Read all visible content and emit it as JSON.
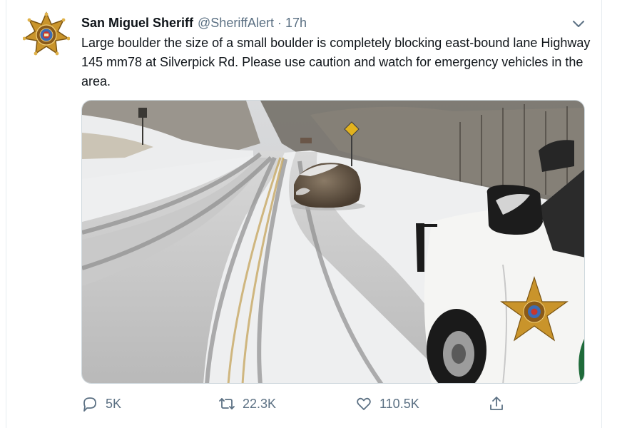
{
  "tweet": {
    "display_name": "San Miguel Sheriff",
    "handle": "@SheriffAlert",
    "separator": "·",
    "time": "17h",
    "text": "Large boulder the size of a small boulder is completely blocking east-bound lane Highway 145 mm78 at Silverpick Rd. Please use caution and watch for emergency vehicles in the area.",
    "avatar_icon": "sheriff-star-badge-icon",
    "menu_icon": "chevron-down-icon"
  },
  "actions": {
    "reply": {
      "icon": "reply-bubble-icon",
      "count": "5K"
    },
    "retweet": {
      "icon": "retweet-arrows-icon",
      "count": "22.3K"
    },
    "like": {
      "icon": "heart-icon",
      "count": "110.5K"
    },
    "share": {
      "icon": "share-upload-icon"
    }
  },
  "colors": {
    "text_primary": "#0f1419",
    "text_secondary": "#5b7083",
    "border": "#e6ecf0",
    "badge_gold": "#c9942b"
  }
}
